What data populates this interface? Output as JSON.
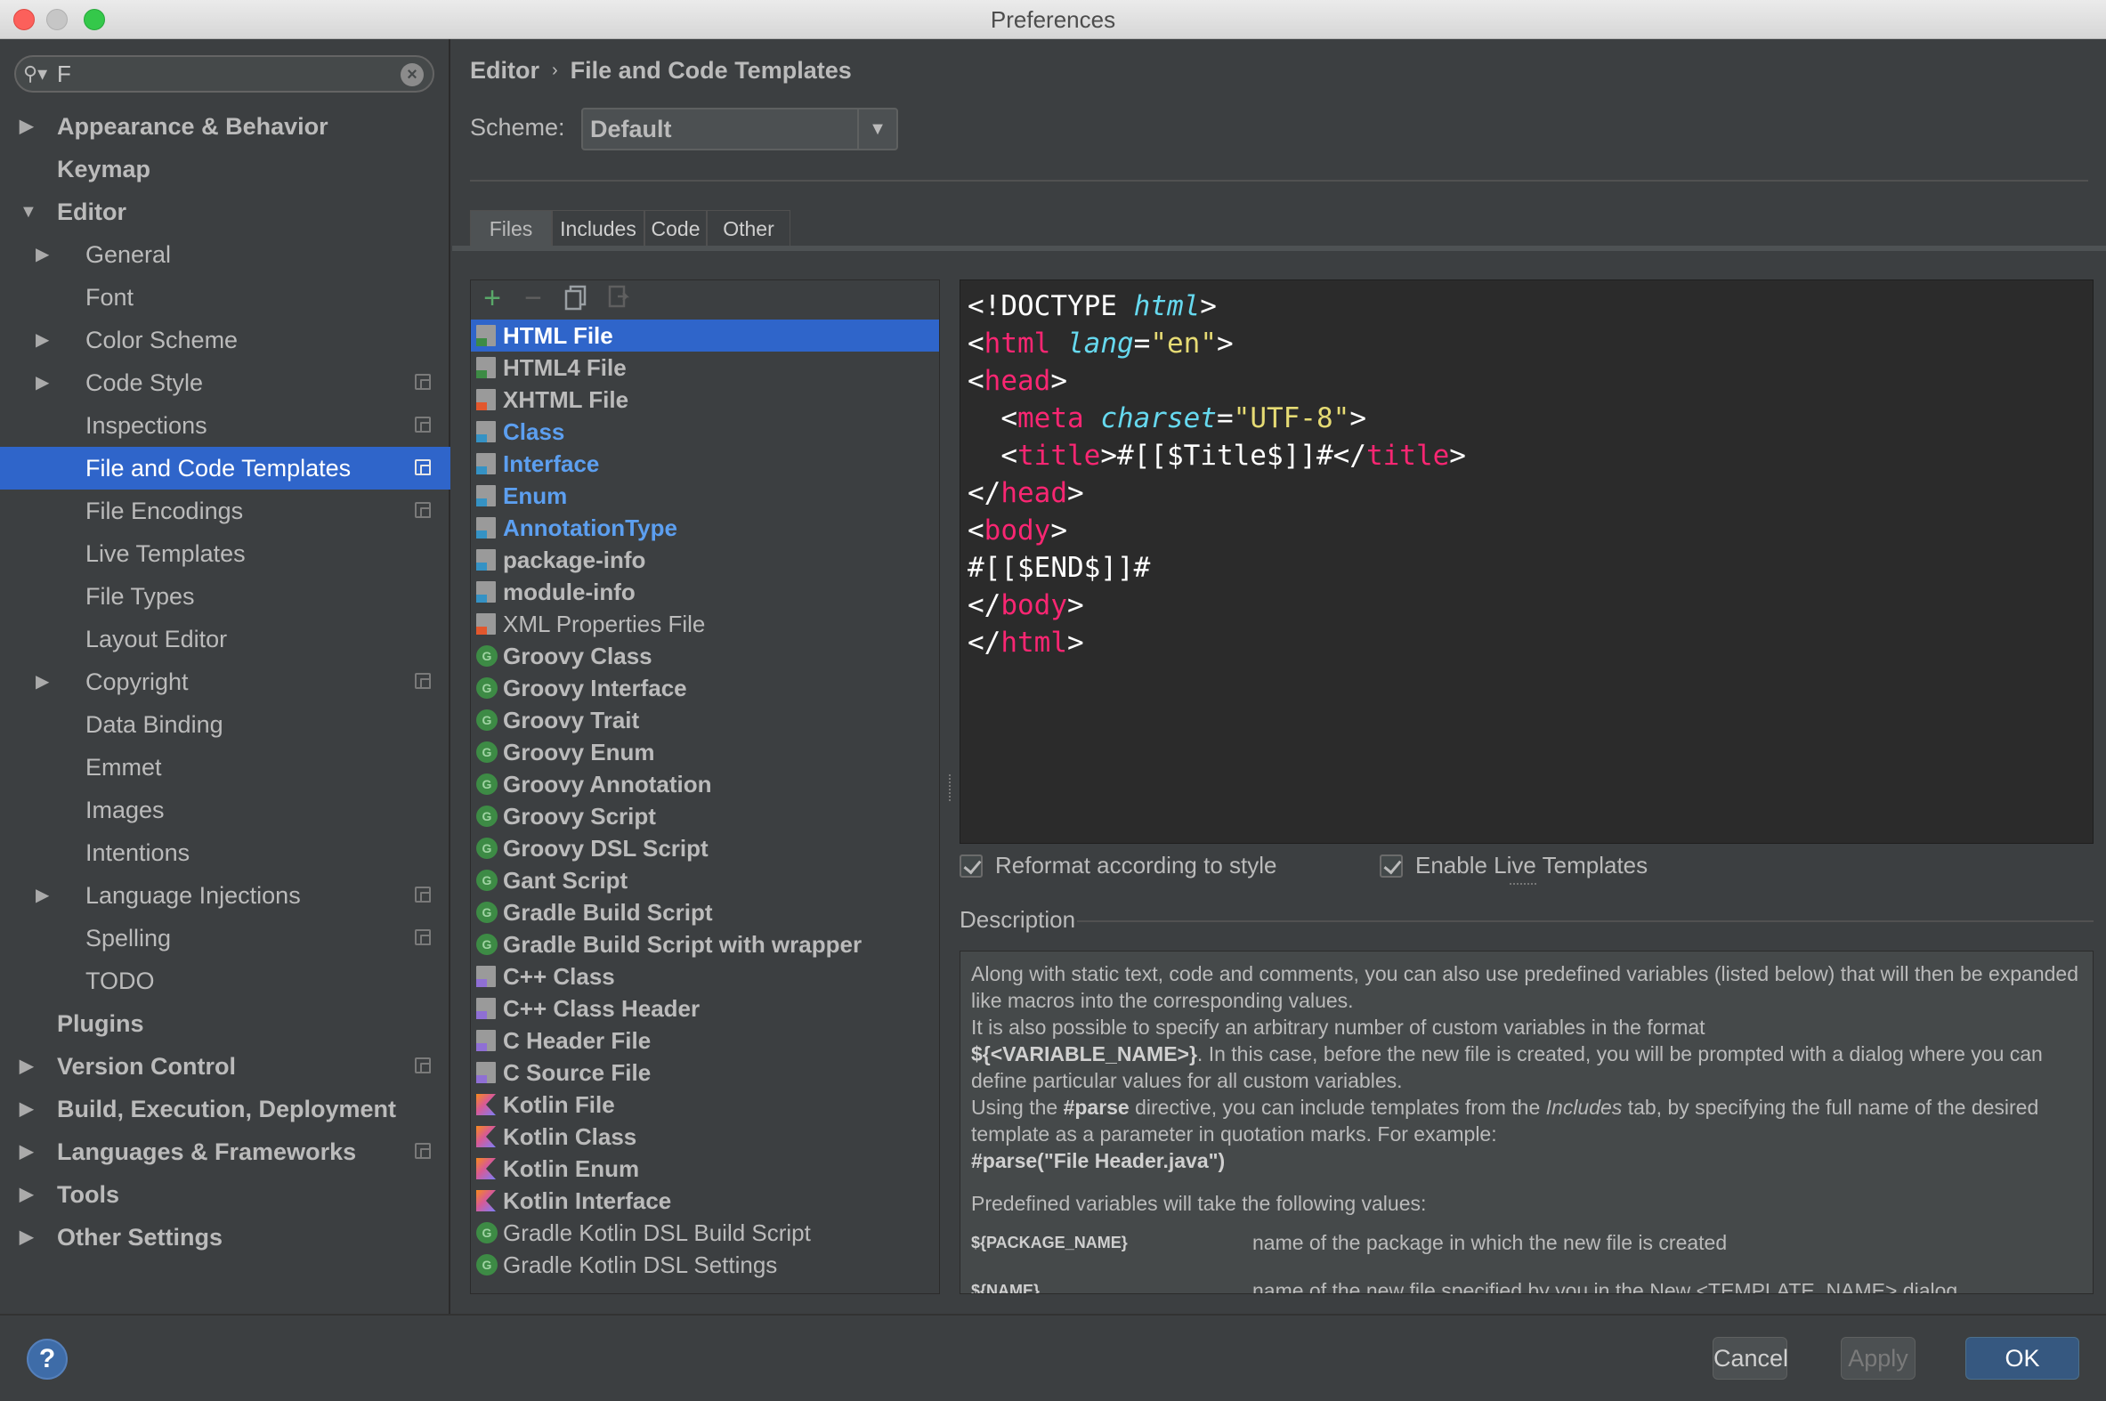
{
  "window": {
    "title": "Preferences"
  },
  "search": {
    "value": "F",
    "icon": "search-icon"
  },
  "sidebar": {
    "items": [
      {
        "label": "Appearance & Behavior",
        "level": 0,
        "arrow": "right",
        "bold": true,
        "proj": false,
        "selected": false
      },
      {
        "label": "Keymap",
        "level": 0,
        "arrow": "",
        "bold": true,
        "proj": false,
        "selected": false
      },
      {
        "label": "Editor",
        "level": 0,
        "arrow": "down",
        "bold": true,
        "proj": false,
        "selected": false
      },
      {
        "label": "General",
        "level": 1,
        "arrow": "right",
        "bold": false,
        "proj": false,
        "selected": false
      },
      {
        "label": "Font",
        "level": 1,
        "arrow": "",
        "bold": false,
        "proj": false,
        "selected": false
      },
      {
        "label": "Color Scheme",
        "level": 1,
        "arrow": "right",
        "bold": false,
        "proj": false,
        "selected": false
      },
      {
        "label": "Code Style",
        "level": 1,
        "arrow": "right",
        "bold": false,
        "proj": true,
        "selected": false
      },
      {
        "label": "Inspections",
        "level": 1,
        "arrow": "",
        "bold": false,
        "proj": true,
        "selected": false
      },
      {
        "label": "File and Code Templates",
        "level": 1,
        "arrow": "",
        "bold": false,
        "proj": true,
        "selected": true
      },
      {
        "label": "File Encodings",
        "level": 1,
        "arrow": "",
        "bold": false,
        "proj": true,
        "selected": false
      },
      {
        "label": "Live Templates",
        "level": 1,
        "arrow": "",
        "bold": false,
        "proj": false,
        "selected": false
      },
      {
        "label": "File Types",
        "level": 1,
        "arrow": "",
        "bold": false,
        "proj": false,
        "selected": false
      },
      {
        "label": "Layout Editor",
        "level": 1,
        "arrow": "",
        "bold": false,
        "proj": false,
        "selected": false
      },
      {
        "label": "Copyright",
        "level": 1,
        "arrow": "right",
        "bold": false,
        "proj": true,
        "selected": false
      },
      {
        "label": "Data Binding",
        "level": 1,
        "arrow": "",
        "bold": false,
        "proj": false,
        "selected": false
      },
      {
        "label": "Emmet",
        "level": 1,
        "arrow": "",
        "bold": false,
        "proj": false,
        "selected": false
      },
      {
        "label": "Images",
        "level": 1,
        "arrow": "",
        "bold": false,
        "proj": false,
        "selected": false
      },
      {
        "label": "Intentions",
        "level": 1,
        "arrow": "",
        "bold": false,
        "proj": false,
        "selected": false
      },
      {
        "label": "Language Injections",
        "level": 1,
        "arrow": "right",
        "bold": false,
        "proj": true,
        "selected": false
      },
      {
        "label": "Spelling",
        "level": 1,
        "arrow": "",
        "bold": false,
        "proj": true,
        "selected": false
      },
      {
        "label": "TODO",
        "level": 1,
        "arrow": "",
        "bold": false,
        "proj": false,
        "selected": false
      },
      {
        "label": "Plugins",
        "level": 0,
        "arrow": "",
        "bold": true,
        "proj": false,
        "selected": false
      },
      {
        "label": "Version Control",
        "level": 0,
        "arrow": "right",
        "bold": true,
        "proj": true,
        "selected": false
      },
      {
        "label": "Build, Execution, Deployment",
        "level": 0,
        "arrow": "right",
        "bold": true,
        "proj": false,
        "selected": false
      },
      {
        "label": "Languages & Frameworks",
        "level": 0,
        "arrow": "right",
        "bold": true,
        "proj": true,
        "selected": false
      },
      {
        "label": "Tools",
        "level": 0,
        "arrow": "right",
        "bold": true,
        "proj": false,
        "selected": false
      },
      {
        "label": "Other Settings",
        "level": 0,
        "arrow": "right",
        "bold": true,
        "proj": false,
        "selected": false
      }
    ]
  },
  "breadcrumb": {
    "parent": "Editor",
    "current": "File and Code Templates"
  },
  "scheme": {
    "label": "Scheme:",
    "value": "Default"
  },
  "tabs": [
    {
      "label": "Files",
      "active": true
    },
    {
      "label": "Includes",
      "active": false
    },
    {
      "label": "Code",
      "active": false
    },
    {
      "label": "Other",
      "active": false
    }
  ],
  "toolbar_icons": [
    "add-icon",
    "remove-icon",
    "copy-icon",
    "reset-icon"
  ],
  "templates": [
    {
      "label": "HTML File",
      "icon": "html",
      "color": "#3d8b45",
      "style": "bold",
      "selected": true
    },
    {
      "label": "HTML4 File",
      "icon": "html",
      "color": "#3d8b45",
      "style": "bold"
    },
    {
      "label": "XHTML File",
      "icon": "html",
      "color": "#e2572d",
      "style": "bold"
    },
    {
      "label": "Class",
      "icon": "java",
      "color": "#3592c4",
      "style": "blue"
    },
    {
      "label": "Interface",
      "icon": "java",
      "color": "#3592c4",
      "style": "blue"
    },
    {
      "label": "Enum",
      "icon": "java",
      "color": "#3592c4",
      "style": "blue"
    },
    {
      "label": "AnnotationType",
      "icon": "java",
      "color": "#3592c4",
      "style": "blue"
    },
    {
      "label": "package-info",
      "icon": "java",
      "color": "#3592c4",
      "style": "bold"
    },
    {
      "label": "module-info",
      "icon": "java",
      "color": "#3592c4",
      "style": "bold"
    },
    {
      "label": "XML Properties File",
      "icon": "xml",
      "color": "#e2572d",
      "style": "normal"
    },
    {
      "label": "Groovy Class",
      "icon": "groovy",
      "style": "bold"
    },
    {
      "label": "Groovy Interface",
      "icon": "groovy",
      "style": "bold"
    },
    {
      "label": "Groovy Trait",
      "icon": "groovy",
      "style": "bold"
    },
    {
      "label": "Groovy Enum",
      "icon": "groovy",
      "style": "bold"
    },
    {
      "label": "Groovy Annotation",
      "icon": "groovy",
      "style": "bold"
    },
    {
      "label": "Groovy Script",
      "icon": "groovy",
      "style": "bold"
    },
    {
      "label": "Groovy DSL Script",
      "icon": "groovy",
      "style": "bold"
    },
    {
      "label": "Gant Script",
      "icon": "groovy",
      "style": "bold"
    },
    {
      "label": "Gradle Build Script",
      "icon": "groovy",
      "style": "bold"
    },
    {
      "label": "Gradle Build Script with wrapper",
      "icon": "groovy",
      "style": "bold"
    },
    {
      "label": "C++ Class",
      "icon": "cpp",
      "color": "#8f6fd4",
      "style": "bold"
    },
    {
      "label": "C++ Class Header",
      "icon": "cpp",
      "color": "#8f6fd4",
      "style": "bold"
    },
    {
      "label": "C Header File",
      "icon": "cpp",
      "color": "#8f6fd4",
      "style": "bold"
    },
    {
      "label": "C Source File",
      "icon": "cpp",
      "color": "#8f6fd4",
      "style": "bold"
    },
    {
      "label": "Kotlin File",
      "icon": "kotlin",
      "style": "bold"
    },
    {
      "label": "Kotlin Class",
      "icon": "kotlin",
      "style": "bold"
    },
    {
      "label": "Kotlin Enum",
      "icon": "kotlin",
      "style": "bold"
    },
    {
      "label": "Kotlin Interface",
      "icon": "kotlin",
      "style": "bold"
    },
    {
      "label": "Gradle Kotlin DSL Build Script",
      "icon": "groovy",
      "style": "normal"
    },
    {
      "label": "Gradle Kotlin DSL Settings",
      "icon": "groovy",
      "style": "normal"
    }
  ],
  "groovy_glyph": "G",
  "editor_lines": [
    [
      [
        "<!DOCTYPE ",
        ""
      ],
      [
        "html",
        "attr"
      ],
      [
        ">",
        ""
      ]
    ],
    [
      [
        "<",
        ""
      ],
      [
        "html",
        "tagn"
      ],
      [
        " ",
        ""
      ],
      [
        "lang",
        "attr"
      ],
      [
        "=",
        ""
      ],
      [
        "\"en\"",
        "str"
      ],
      [
        ">",
        ""
      ]
    ],
    [
      [
        "<",
        ""
      ],
      [
        "head",
        "tagn"
      ],
      [
        ">",
        ""
      ]
    ],
    [
      [
        "  <",
        ""
      ],
      [
        "meta",
        "tagn"
      ],
      [
        " ",
        ""
      ],
      [
        "charset",
        "attr"
      ],
      [
        "=",
        ""
      ],
      [
        "\"UTF-8\"",
        "str"
      ],
      [
        ">",
        ""
      ]
    ],
    [
      [
        "  <",
        ""
      ],
      [
        "title",
        "tagn"
      ],
      [
        ">#[[$Title$]]#</",
        ""
      ],
      [
        "title",
        "tagn"
      ],
      [
        ">",
        ""
      ]
    ],
    [
      [
        "</",
        ""
      ],
      [
        "head",
        "tagn"
      ],
      [
        ">",
        ""
      ]
    ],
    [
      [
        "<",
        ""
      ],
      [
        "body",
        "tagn"
      ],
      [
        ">",
        ""
      ]
    ],
    [
      [
        "#[[$END$]]#",
        ""
      ]
    ],
    [
      [
        "</",
        ""
      ],
      [
        "body",
        "tagn"
      ],
      [
        ">",
        ""
      ]
    ],
    [
      [
        "</",
        ""
      ],
      [
        "html",
        "tagn"
      ],
      [
        ">",
        ""
      ]
    ]
  ],
  "options": {
    "reformat": {
      "label": "Reformat according to style",
      "checked": true
    },
    "live_templates": {
      "label": "Enable Live Templates",
      "checked": true
    }
  },
  "description": {
    "title": "Description",
    "p1_a": "Along with static text, code and comments, you can also use predefined variables (listed below) that will then be expanded like macros into the corresponding values.",
    "p1_b": "It is also possible to specify an arbitrary number of custom variables in the format",
    "p1_var": "${<VARIABLE_NAME>}",
    "p1_c": ". In this case, before the new file is created, you will be prompted with a dialog where you can define particular values for all custom variables.",
    "p1_d": "Using the ",
    "p1_parse": "#parse",
    "p1_e": " directive, you can include templates from the ",
    "p1_includes": "Includes",
    "p1_f": " tab, by specifying the full name of the desired template as a parameter in quotation marks. For example:",
    "p1_example": "#parse(\"File Header.java\")",
    "predefined": "Predefined variables will take the following values:",
    "vars": [
      {
        "name": "${PACKAGE_NAME}",
        "desc": "name of the package in which the new file is created"
      },
      {
        "name": "${NAME}",
        "desc": "name of the new file specified by you in the New <TEMPLATE_NAME> dialog"
      }
    ]
  },
  "buttons": {
    "help": "?",
    "cancel": "Cancel",
    "apply": "Apply",
    "ok": "OK"
  }
}
